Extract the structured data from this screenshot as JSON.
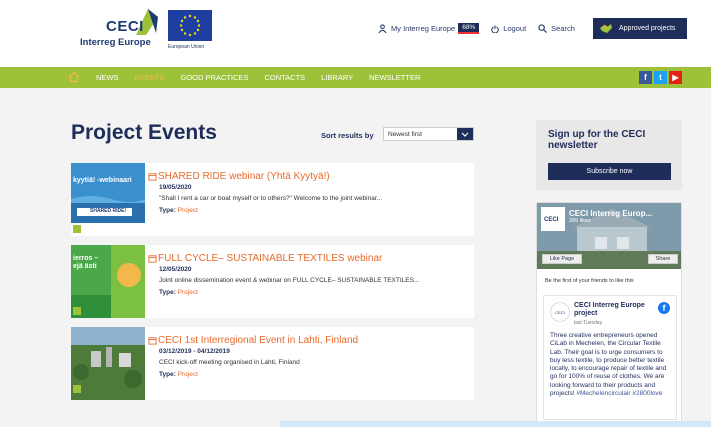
{
  "header": {
    "logo_name": "CECI",
    "logo_program": "Interreg Europe",
    "eu_label": "European Union",
    "my_interreg": "My Interreg Europe",
    "progress": "68%",
    "logout": "Logout",
    "search": "Search",
    "approved_projects": "Approved projects"
  },
  "nav": {
    "items": [
      {
        "label": "News",
        "active": false
      },
      {
        "label": "Events",
        "active": true
      },
      {
        "label": "Good Practices",
        "active": false
      },
      {
        "label": "Contacts",
        "active": false
      },
      {
        "label": "Library",
        "active": false
      },
      {
        "label": "Newsletter",
        "active": false
      }
    ],
    "social": [
      "f",
      "t",
      "▶"
    ]
  },
  "main": {
    "title": "Project Events",
    "sort_label": "Sort results by",
    "sort_value": "Newest first"
  },
  "events": [
    {
      "title": "SHARED RIDE webinar (Yhtä Kyytyä!)",
      "date": "19/05/2020",
      "desc": "\"Shall I rent a car or boat myself or to others?\" Welcome to the joint webinar...",
      "type_label": "Type:",
      "type_value": "Project",
      "image_text": "kyytiä! -webinaari"
    },
    {
      "title": "FULL CYCLE– SUSTAINABLE TEXTILES webinar",
      "date": "12/05/2020",
      "desc": "Joint online dissemination event & webinar on FULL CYCLE– SUSTAINABLE TEXTILES...",
      "type_label": "Type:",
      "type_value": "Project",
      "image_text": "ierros – ejä ästi"
    },
    {
      "title": "CECI 1st Interregional Event in Lahti, Finland",
      "date": "03/12/2019 - 04/12/2019",
      "desc": "CECI kick-off meeting organised in Lahti, Finland",
      "type_label": "Type:",
      "type_value": "Project",
      "image_text": ""
    }
  ],
  "sidebar": {
    "newsletter_title": "Sign up for the CECI newsletter",
    "subscribe": "Subscribe now",
    "fb": {
      "page_name": "CECI Interreg Europ...",
      "likes": "285 likes",
      "like_page": "Like Page",
      "share": "Share",
      "friends": "Be the first of your friends to like this",
      "post_name": "CECI Interreg Europe project",
      "post_time": "last Tuesday",
      "post_text": "Three creative entrepreneurs opened CiLab in Mechelen, the Circular Textile Lab. Their goal is to urge consumers to buy less textile, to produce better textile locally, to encourage repair of textile and go for 100% of reuse of clothes. We are looking forward to their products and projects!",
      "post_tags": "#Mechelencirculair #2800love"
    }
  },
  "colors": {
    "navy": "#1f2d5a",
    "green": "#9dc23a",
    "orange": "#e86a2a"
  }
}
